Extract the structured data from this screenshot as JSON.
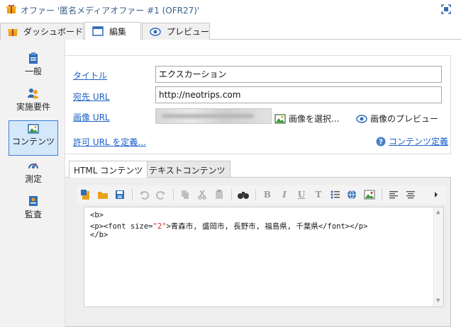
{
  "window": {
    "title": "オファー '匿名メディアオファー #1 (OFR27)'"
  },
  "tabs": [
    {
      "label": "ダッシュボード",
      "icon": "gift-icon"
    },
    {
      "label": "編集",
      "icon": "window-icon",
      "active": true
    },
    {
      "label": "プレビュー",
      "icon": "eye-icon"
    }
  ],
  "sidebar": {
    "items": [
      {
        "label": "一般",
        "icon": "clipboard-icon"
      },
      {
        "label": "実施要件",
        "icon": "people-icon"
      },
      {
        "label": "コンテンツ",
        "icon": "image-icon",
        "active": true
      },
      {
        "label": "測定",
        "icon": "gauge-icon"
      },
      {
        "label": "監査",
        "icon": "audit-icon"
      }
    ]
  },
  "form": {
    "title_label": "タイトル",
    "title_value": "エクスカーション",
    "dest_url_label": "宛先 URL",
    "dest_url_value": "http://neotrips.com",
    "image_url_label": "画像 URL",
    "select_image": "画像を選択...",
    "preview_image": "画像のプレビュー",
    "allowed_url": "許可 URL を定義...",
    "content_definition": "コンテンツ定義"
  },
  "content_tabs": [
    {
      "label": "HTML コンテンツ",
      "active": true
    },
    {
      "label": "テキストコンテンツ"
    }
  ],
  "editor": {
    "lines": [
      {
        "pre": "<b>",
        "str": "",
        "post": ""
      },
      {
        "pre": "<p><font size=",
        "str": "\"2\"",
        "post": ">青森市, 盛岡市, 長野市, 福島県, 千葉県</font></p>"
      },
      {
        "pre": "</b>",
        "str": "",
        "post": ""
      }
    ],
    "toolbar_letters": {
      "bold": "B",
      "italic": "I",
      "underline": "U",
      "clear": "T"
    }
  },
  "colors": {
    "link": "#1a5fc7",
    "accent": "#3d7dd6",
    "active_nav": "#d4e8fb"
  }
}
